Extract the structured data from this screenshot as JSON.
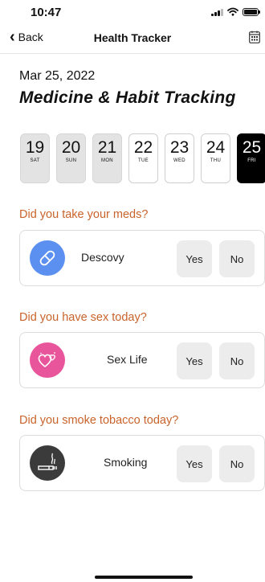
{
  "status_bar": {
    "time": "10:47"
  },
  "nav": {
    "back_label": "Back",
    "title": "Health Tracker"
  },
  "date_label": "Mar 25, 2022",
  "heading": "Medicine & Habit Tracking",
  "days": [
    {
      "num": "19",
      "weekday": "SAT",
      "state": "past"
    },
    {
      "num": "20",
      "weekday": "SUN",
      "state": "past"
    },
    {
      "num": "21",
      "weekday": "MON",
      "state": "past"
    },
    {
      "num": "22",
      "weekday": "TUE",
      "state": "future"
    },
    {
      "num": "23",
      "weekday": "WED",
      "state": "future"
    },
    {
      "num": "24",
      "weekday": "THU",
      "state": "future"
    },
    {
      "num": "25",
      "weekday": "FRI",
      "state": "selected"
    }
  ],
  "trackers": [
    {
      "question": "Did you take your meds?",
      "label": "Descovy",
      "icon": "pill-icon",
      "color": "#5b8ff0",
      "yes": "Yes",
      "no": "No"
    },
    {
      "question": "Did you have sex today?",
      "label": "Sex Life",
      "icon": "hearts-icon",
      "color": "#e8559b",
      "yes": "Yes",
      "no": "No"
    },
    {
      "question": "Did you smoke tobacco today?",
      "label": "Smoking",
      "icon": "cigarette-icon",
      "color": "#3b3b3b",
      "yes": "Yes",
      "no": "No"
    }
  ],
  "colors": {
    "accent": "#c8632b",
    "selected_day": "#000000",
    "past_day": "#e3e3e3"
  }
}
